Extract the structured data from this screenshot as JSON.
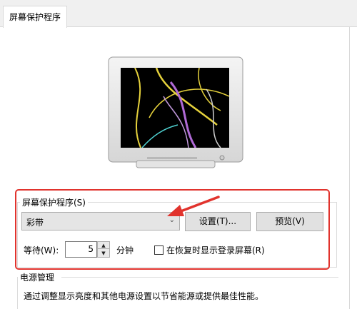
{
  "tab": {
    "label": "屏幕保护程序"
  },
  "screensaver_group": {
    "title": "屏幕保护程序(S)",
    "selected": "彩带",
    "settings_button": "设置(T)...",
    "preview_button": "预览(V)"
  },
  "wait": {
    "label": "等待(W):",
    "value": "5",
    "unit": "分钟"
  },
  "resume_checkbox": {
    "label": "在恢复时显示登录屏幕(R)",
    "checked": false
  },
  "power_group": {
    "title": "电源管理",
    "description": "通过调整显示亮度和其他电源设置以节省能源或提供最佳性能。"
  },
  "colors": {
    "annotation": "#e1332d",
    "ribbon_yellow": "#e6d23c",
    "ribbon_purple": "#b06ad6",
    "ribbon_cyan": "#4fd2d2"
  }
}
